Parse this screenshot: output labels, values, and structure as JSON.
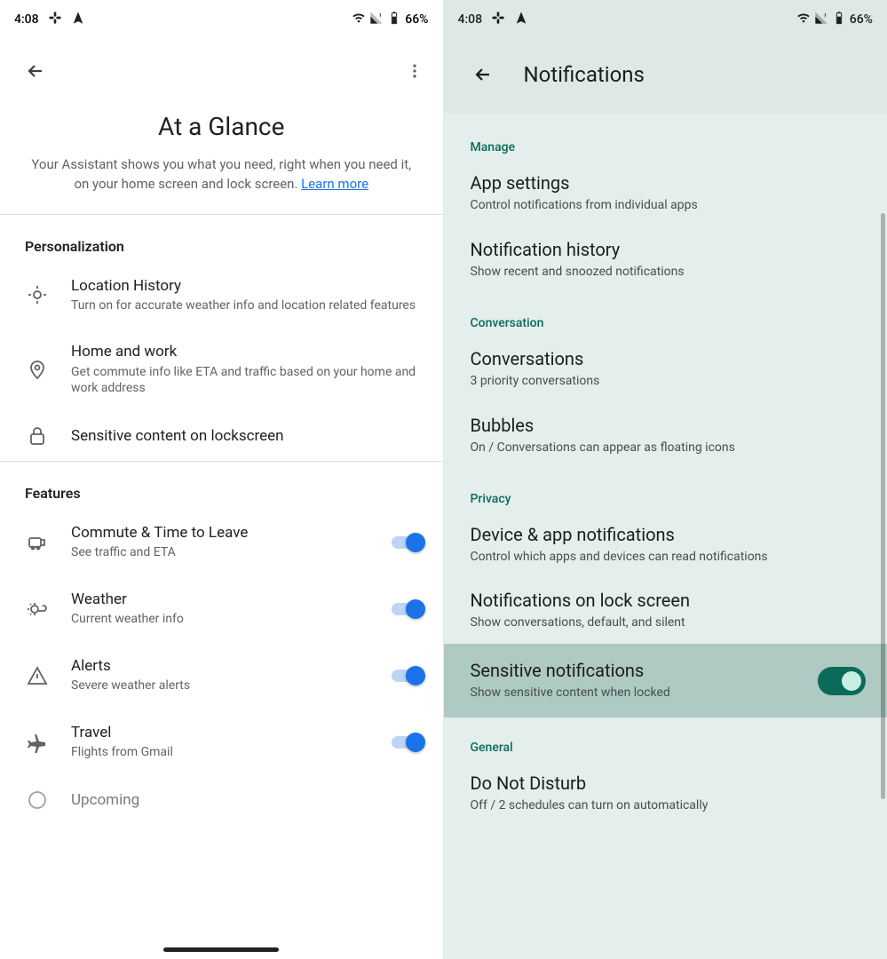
{
  "status": {
    "time": "4:08",
    "battery": "66%"
  },
  "left": {
    "title": "At a Glance",
    "subtitle_pre": "Your Assistant shows you what you need, right when you need it, on your home screen and lock screen. ",
    "learn_more": "Learn more",
    "sections": {
      "personalization": "Personalization",
      "features": "Features"
    },
    "items": {
      "location": {
        "title": "Location History",
        "sub": "Turn on for accurate weather info and location related features"
      },
      "homework": {
        "title": "Home and work",
        "sub": "Get commute info like ETA and traffic based on your home and work address"
      },
      "sensitive": {
        "title": "Sensitive content on lockscreen"
      },
      "commute": {
        "title": "Commute & Time to Leave",
        "sub": "See traffic and ETA"
      },
      "weather": {
        "title": "Weather",
        "sub": "Current weather info"
      },
      "alerts": {
        "title": "Alerts",
        "sub": "Severe weather alerts"
      },
      "travel": {
        "title": "Travel",
        "sub": "Flights from Gmail"
      },
      "upcoming": {
        "title": "Upcoming"
      }
    }
  },
  "right": {
    "title": "Notifications",
    "cats": {
      "manage": "Manage",
      "conversation": "Conversation",
      "privacy": "Privacy",
      "general": "General"
    },
    "items": {
      "appsettings": {
        "title": "App settings",
        "sub": "Control notifications from individual apps"
      },
      "history": {
        "title": "Notification history",
        "sub": "Show recent and snoozed notifications"
      },
      "conversations": {
        "title": "Conversations",
        "sub": "3 priority conversations"
      },
      "bubbles": {
        "title": "Bubbles",
        "sub": "On / Conversations can appear as floating icons"
      },
      "deviceapp": {
        "title": "Device & app notifications",
        "sub": "Control which apps and devices can read notifications"
      },
      "lockscreen": {
        "title": "Notifications on lock screen",
        "sub": "Show conversations, default, and silent"
      },
      "sensitive": {
        "title": "Sensitive notifications",
        "sub": "Show sensitive content when locked"
      },
      "dnd": {
        "title": "Do Not Disturb",
        "sub": "Off / 2 schedules can turn on automatically"
      }
    }
  }
}
